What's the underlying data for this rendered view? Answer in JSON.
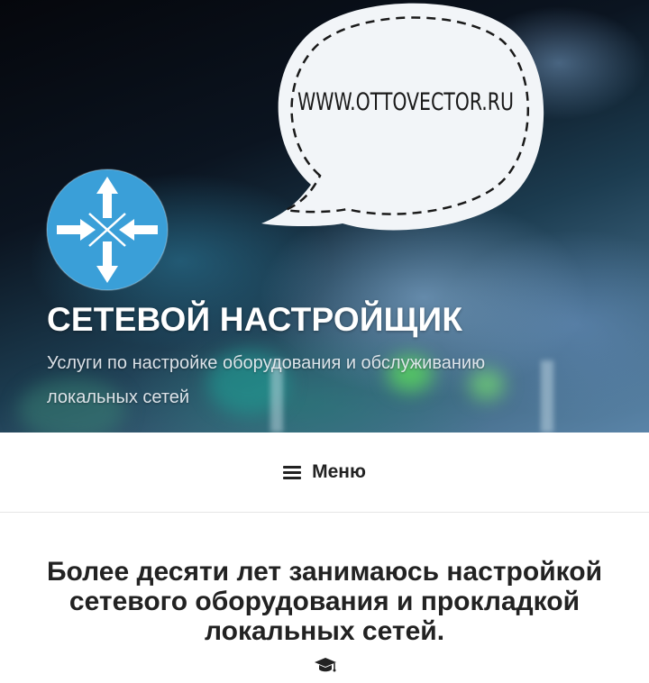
{
  "header": {
    "bubble_text": "WWW.OTTOVECTOR.RU",
    "site_title": "СЕТЕВОЙ НАСТРОЙЩИК",
    "tagline": "Услуги по настройке оборудования и обслуживанию локальных сетей",
    "logo_icon": "network-router-icon"
  },
  "nav": {
    "menu_label": "Меню",
    "menu_icon": "hamburger-icon"
  },
  "main": {
    "intro_heading": "Более десяти лет занимаюсь настройкой сетевого оборудования и прокладкой локальных сетей.",
    "intro_icon": "graduation-cap-icon"
  },
  "colors": {
    "logo_blue": "#3a9fd8",
    "bubble_fill": "#f2f5f8",
    "text_dark": "#222222",
    "title_white": "#ffffff"
  }
}
